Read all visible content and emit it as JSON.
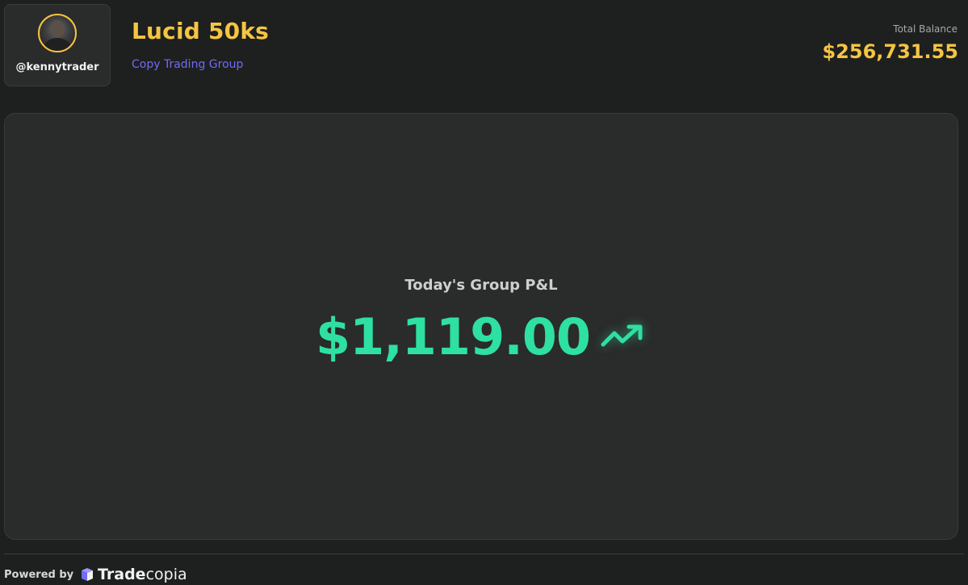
{
  "profile": {
    "username": "@kennytrader"
  },
  "group": {
    "name": "Lucid 50ks",
    "type_label": "Copy Trading Group"
  },
  "balance": {
    "label": "Total Balance",
    "value": "$256,731.55"
  },
  "pnl": {
    "label": "Today's Group P&L",
    "value": "$1,119.00",
    "trend_icon": "trending-up-icon"
  },
  "footer": {
    "powered_by": "Powered by",
    "brand_strong": "Trade",
    "brand_light": "copia"
  },
  "colors": {
    "background": "#1e1f1f",
    "panel": "#2a2b2b",
    "accent_yellow": "#f5c542",
    "accent_purple": "#6f6df2",
    "positive_green": "#2ee0a1"
  }
}
